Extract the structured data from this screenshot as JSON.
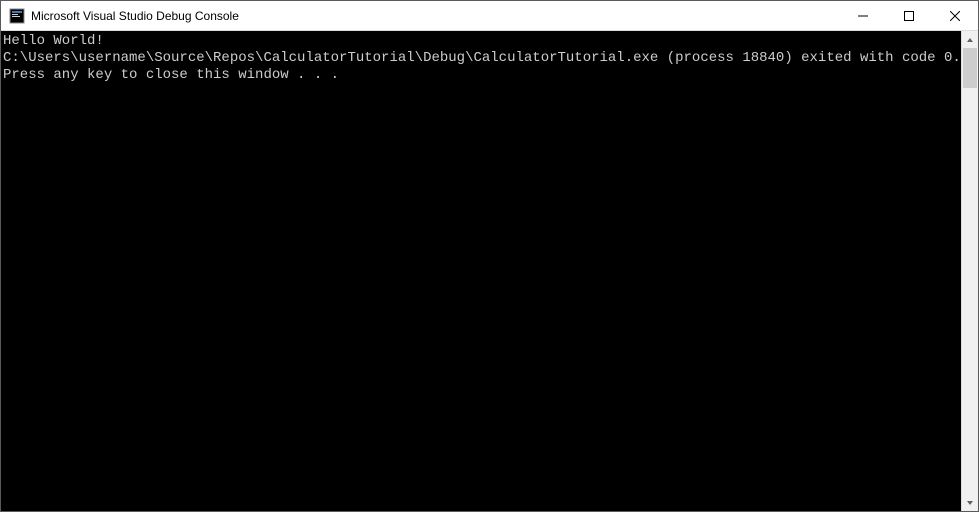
{
  "window": {
    "title": "Microsoft Visual Studio Debug Console"
  },
  "console": {
    "line1": "Hello World!",
    "line2": "",
    "line3": "C:\\Users\\username\\Source\\Repos\\CalculatorTutorial\\Debug\\CalculatorTutorial.exe (process 18840) exited with code 0.",
    "line4": "Press any key to close this window . . ."
  }
}
